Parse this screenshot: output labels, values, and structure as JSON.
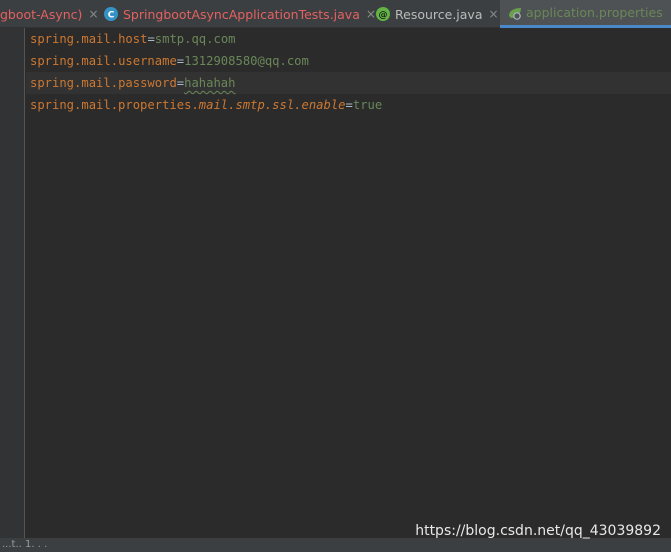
{
  "tabs": [
    {
      "label": "gboot-Async)",
      "color": "#e46161",
      "icon": "none",
      "active": false
    },
    {
      "label": "SpringbootAsyncApplicationTests.java",
      "color": "#e46161",
      "icon": "java-class-icon",
      "active": false
    },
    {
      "label": "Resource.java",
      "color": "#bbbbbb",
      "icon": "annotation-icon",
      "active": false
    },
    {
      "label": "application.properties",
      "color": "#6a8759",
      "icon": "spring-leaf-icon",
      "active": true
    }
  ],
  "tab_close_glyph": "×",
  "code_lines": [
    {
      "parts": [
        "spring",
        ".",
        "mail",
        ".",
        "host"
      ],
      "eq": "=",
      "value": "smtp.qq.com"
    },
    {
      "parts": [
        "spring",
        ".",
        "mail",
        ".",
        "username"
      ],
      "eq": "=",
      "value": "1312908580@qq.com"
    },
    {
      "parts": [
        "spring",
        ".",
        "mail",
        ".",
        "password"
      ],
      "eq": "=",
      "value": "hahahah"
    },
    {
      "key_plain": "spring.mail.properties.",
      "key_italic": "mail.smtp.ssl.enable",
      "eq": "=",
      "value": "true"
    }
  ],
  "status_text": "...t.. 1. . .",
  "watermark": "https://blog.csdn.net/qq_43039892",
  "colors": {
    "background": "#2b2b2b",
    "key": "#cc7832",
    "value": "#6a8759",
    "error_tab": "#e46161",
    "active_underline": "#4a88c7"
  }
}
